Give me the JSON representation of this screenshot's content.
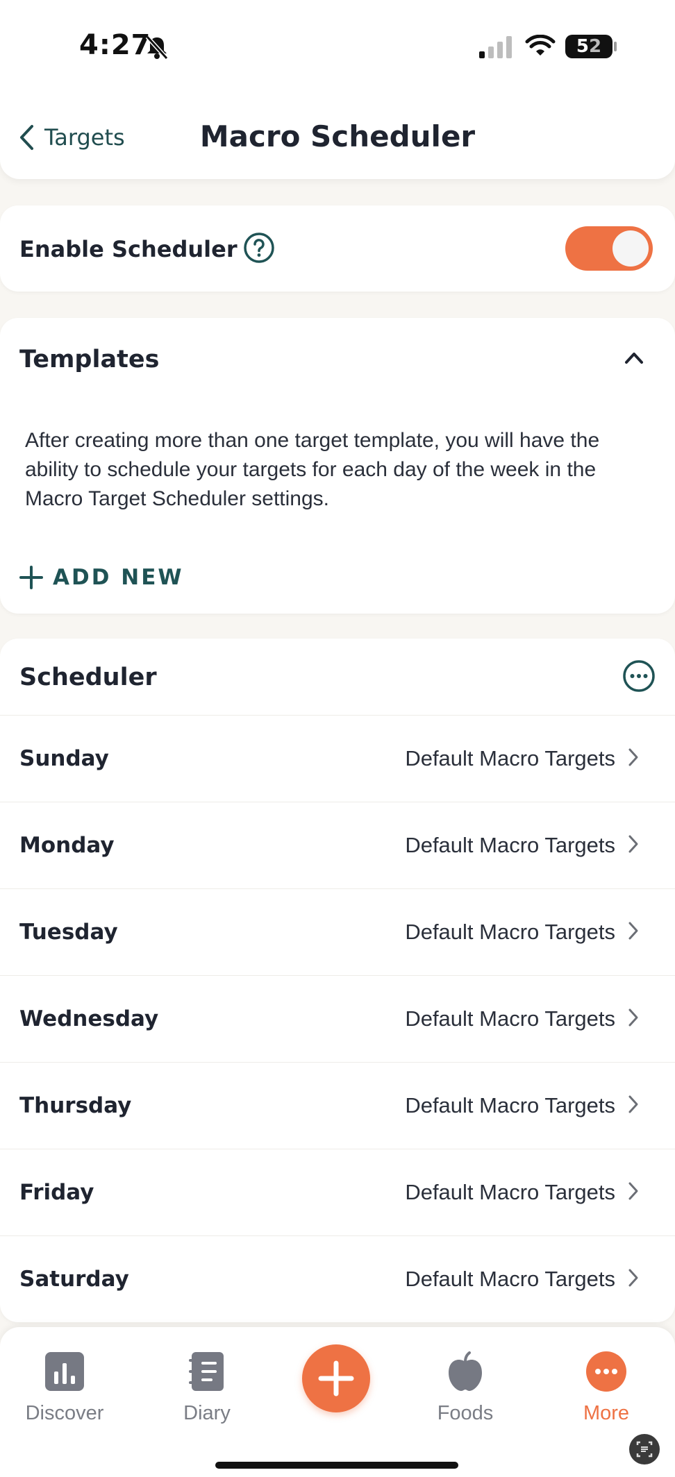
{
  "status_bar": {
    "time": "4:27",
    "battery_main": "5",
    "battery_rest": "2"
  },
  "header": {
    "back_label": "Targets",
    "title": "Macro Scheduler"
  },
  "enable": {
    "label": "Enable Scheduler",
    "toggle_on": true
  },
  "templates": {
    "title": "Templates",
    "description": "After creating more than one target template, you will have the ability to schedule your targets for each day of the week in the Macro Target Scheduler settings.",
    "add_new_label": "ADD NEW"
  },
  "scheduler": {
    "title": "Scheduler",
    "rows": [
      {
        "day": "Sunday",
        "target": "Default Macro Targets"
      },
      {
        "day": "Monday",
        "target": "Default Macro Targets"
      },
      {
        "day": "Tuesday",
        "target": "Default Macro Targets"
      },
      {
        "day": "Wednesday",
        "target": "Default Macro Targets"
      },
      {
        "day": "Thursday",
        "target": "Default Macro Targets"
      },
      {
        "day": "Friday",
        "target": "Default Macro Targets"
      },
      {
        "day": "Saturday",
        "target": "Default Macro Targets"
      }
    ]
  },
  "nav": {
    "tabs": [
      {
        "label": "Discover",
        "icon": "chart-icon"
      },
      {
        "label": "Diary",
        "icon": "notebook-icon"
      },
      {
        "label": "Foods",
        "icon": "apple-icon"
      },
      {
        "label": "More",
        "icon": "more-dots-icon"
      }
    ],
    "active": "More"
  },
  "colors": {
    "accent": "#ee7244",
    "teal": "#1f5355",
    "text": "#1f2430"
  }
}
